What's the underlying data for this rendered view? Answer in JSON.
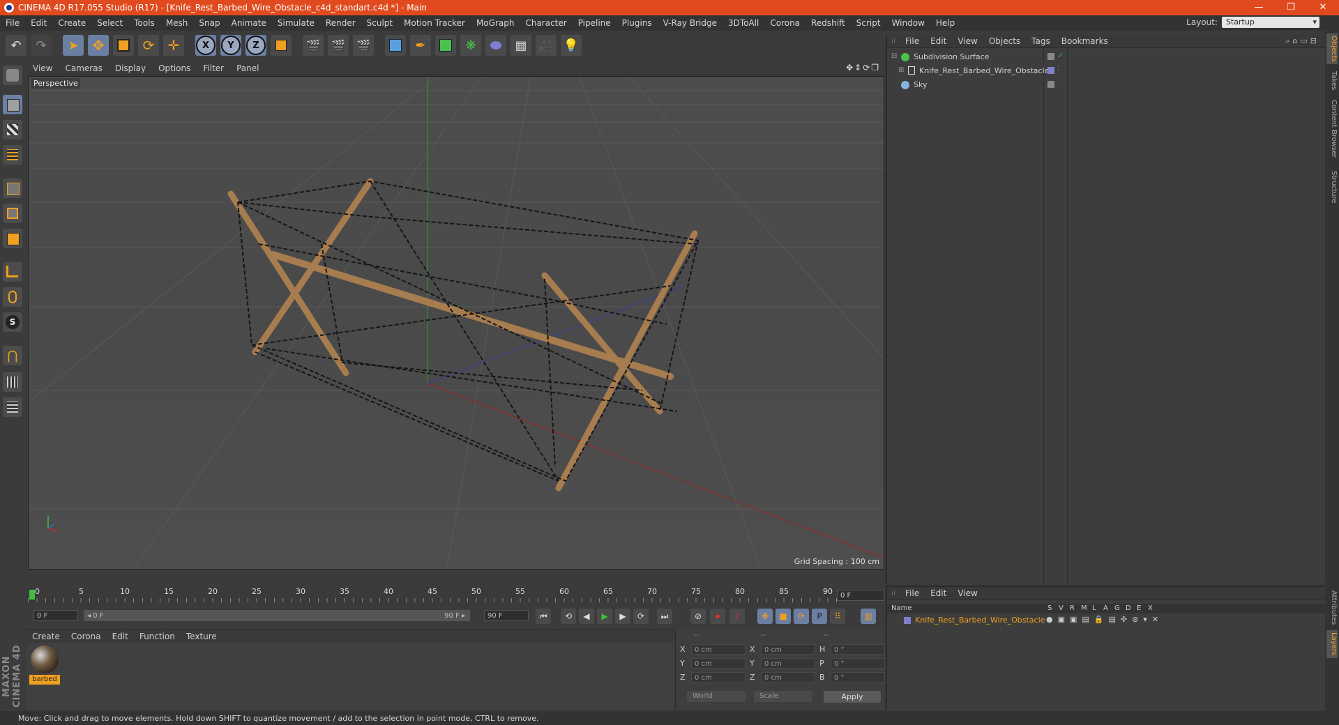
{
  "window": {
    "title": "CINEMA 4D R17.055 Studio (R17) - [Knife_Rest_Barbed_Wire_Obstacle_c4d_standart.c4d *] - Main",
    "minimize": "—",
    "restore": "❐",
    "close": "✕"
  },
  "menubar": {
    "items": [
      "File",
      "Edit",
      "Create",
      "Select",
      "Tools",
      "Mesh",
      "Snap",
      "Animate",
      "Simulate",
      "Render",
      "Sculpt",
      "Motion Tracker",
      "MoGraph",
      "Character",
      "Pipeline",
      "Plugins",
      "V-Ray Bridge",
      "3DToAll",
      "Corona",
      "Redshift",
      "Script",
      "Window",
      "Help"
    ],
    "layout_label": "Layout:",
    "layout_value": "Startup"
  },
  "toolbar": {
    "axis_x": "X",
    "axis_y": "Y",
    "axis_z": "Z"
  },
  "viewport": {
    "menu": [
      "View",
      "Cameras",
      "Display",
      "Options",
      "Filter",
      "Panel"
    ],
    "label": "Perspective",
    "grid_spacing": "Grid Spacing : 100 cm",
    "nav_icons": "✥⇕⟳❐"
  },
  "timeline": {
    "ticks": [
      "0",
      "5",
      "10",
      "15",
      "20",
      "25",
      "30",
      "35",
      "40",
      "45",
      "50",
      "55",
      "60",
      "65",
      "70",
      "75",
      "80",
      "85",
      "90"
    ],
    "current_frame": "0 F",
    "start_field": "0 F",
    "range_start": "◂ 0 F",
    "range_end": "90 F ▸",
    "end_field": "90 F"
  },
  "material_manager": {
    "menu": [
      "Create",
      "Corona",
      "Edit",
      "Function",
      "Texture"
    ],
    "material_name": "barbed"
  },
  "coordinates": {
    "headers": [
      "--",
      "--",
      "--"
    ],
    "rows": [
      {
        "a1": "X",
        "v1": "0 cm",
        "a2": "X",
        "v2": "0 cm",
        "a3": "H",
        "v3": "0 °"
      },
      {
        "a1": "Y",
        "v1": "0 cm",
        "a2": "Y",
        "v2": "0 cm",
        "a3": "P",
        "v3": "0 °"
      },
      {
        "a1": "Z",
        "v1": "0 cm",
        "a2": "Z",
        "v2": "0 cm",
        "a3": "B",
        "v3": "0 °"
      }
    ],
    "space": "World",
    "mode": "Scale",
    "apply": "Apply"
  },
  "object_manager": {
    "menu": [
      "File",
      "Edit",
      "View",
      "Objects",
      "Tags",
      "Bookmarks"
    ],
    "objects": [
      {
        "name": "Subdivision Surface",
        "color": "#4cc14c"
      },
      {
        "name": "Knife_Rest_Barbed_Wire_Obstacle",
        "color": "#7f7fd0"
      },
      {
        "name": "Sky",
        "color": "#8ab4e0"
      }
    ]
  },
  "layer_manager": {
    "menu": [
      "File",
      "Edit",
      "View"
    ],
    "columns": [
      "Name",
      "S",
      "V",
      "R",
      "M",
      "L",
      "A",
      "G",
      "D",
      "E",
      "X"
    ],
    "layer_name": "Knife_Rest_Barbed_Wire_Obstacle"
  },
  "side_tabs": [
    "Objects",
    "Takes",
    "Content Browser",
    "Structure",
    "Attributes",
    "Layers"
  ],
  "branding": "MAXON CINEMA 4D",
  "statusbar": {
    "text": "Move: Click and drag to move elements. Hold down SHIFT to quantize movement / add to the selection in point mode, CTRL to remove."
  },
  "colors": {
    "title_bar": "#e04a1e",
    "accent": "#f0a020",
    "selected_tool": "#6b7fa3"
  }
}
